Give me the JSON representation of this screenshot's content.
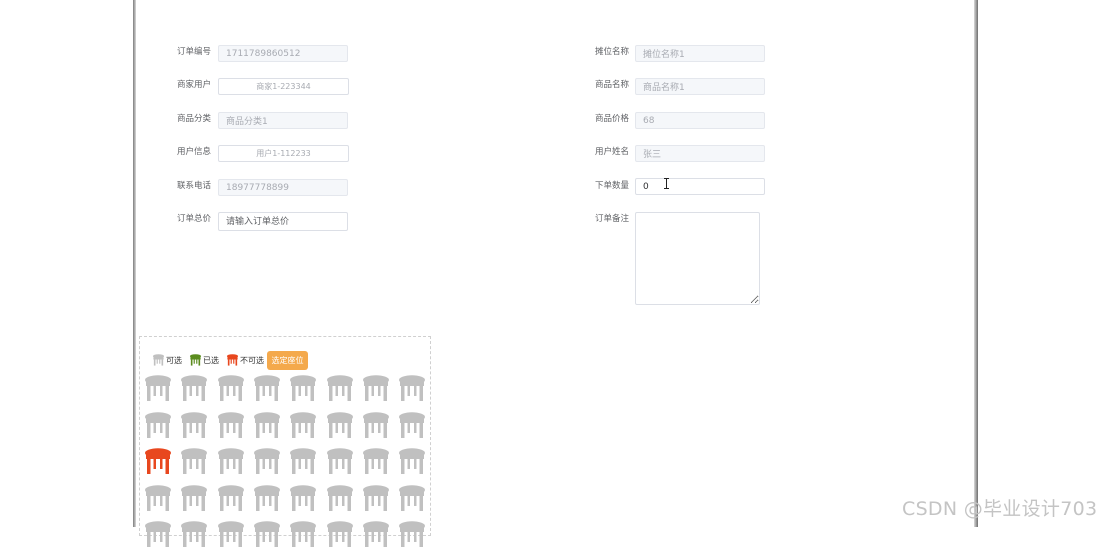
{
  "form": {
    "order_no": {
      "label": "订单编号",
      "value": "1711789860512"
    },
    "merchant_user": {
      "label": "商家用户",
      "value": "商家1-223344"
    },
    "product_category": {
      "label": "商品分类",
      "value": "商品分类1"
    },
    "user_info": {
      "label": "用户信息",
      "value": "用户1-112233"
    },
    "phone": {
      "label": "联系电话",
      "value": "18977778899"
    },
    "order_total": {
      "label": "订单总价",
      "placeholder": "请输入订单总价"
    },
    "stall_name": {
      "label": "摊位名称",
      "value": "摊位名称1"
    },
    "product_name": {
      "label": "商品名称",
      "value": "商品名称1"
    },
    "product_price": {
      "label": "商品价格",
      "value": "68"
    },
    "user_name": {
      "label": "用户姓名",
      "value": "张三"
    },
    "order_qty": {
      "label": "下单数量",
      "value": "0"
    },
    "order_note": {
      "label": "订单备注",
      "value": ""
    }
  },
  "seat_picker": {
    "legend": [
      {
        "label": "可选",
        "color": "#c0c0c0"
      },
      {
        "label": "已选",
        "color": "#5b8c1e"
      },
      {
        "label": "不可选",
        "color": "#e8471e"
      }
    ],
    "choose_button": "选定座位",
    "colors": {
      "available": "#c0c0c0",
      "selected": "#5b8c1e",
      "unavailable": "#e8471e"
    },
    "columns": 8,
    "rows": [
      [
        "available",
        "available",
        "available",
        "available",
        "available",
        "available",
        "available",
        "available"
      ],
      [
        "available",
        "available",
        "available",
        "available",
        "available",
        "available",
        "available",
        "available"
      ],
      [
        "unavailable",
        "available",
        "available",
        "available",
        "available",
        "available",
        "available",
        "available"
      ],
      [
        "available",
        "available",
        "available",
        "available",
        "available",
        "available",
        "available",
        "available"
      ],
      [
        "available",
        "available",
        "available",
        "available",
        "available",
        "available",
        "available",
        "available"
      ]
    ]
  },
  "watermark": "CSDN @毕业设计703"
}
